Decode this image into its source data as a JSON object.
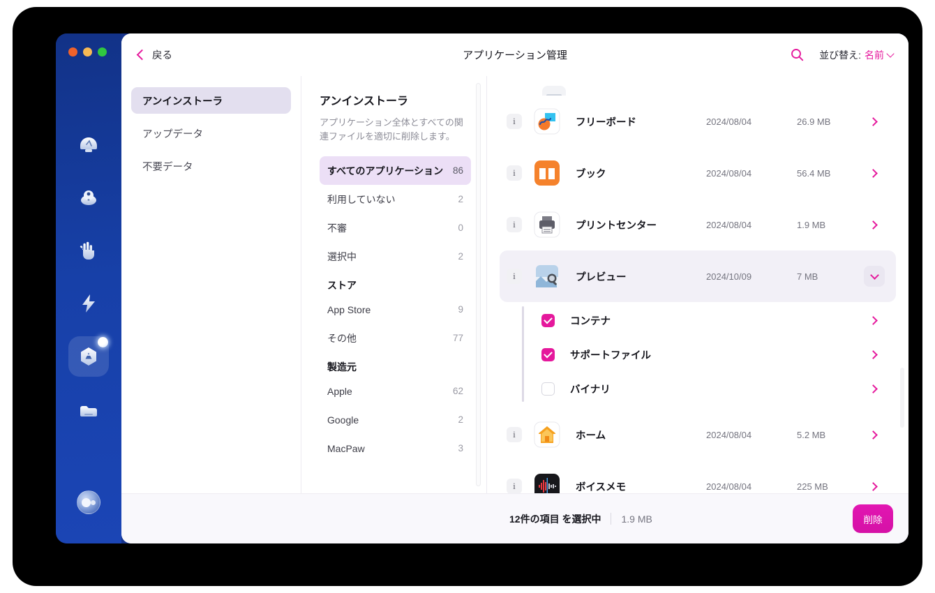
{
  "window": {
    "title": "アプリケーション管理",
    "back_label": "戻る",
    "traffic_lights": [
      "close",
      "minimize",
      "zoom"
    ]
  },
  "toolbar": {
    "search_icon": "search-icon",
    "sort_label": "並び替え:",
    "sort_value": "名前",
    "sort_caret_icon": "chevron-down-icon",
    "accent_color": "#e5189c"
  },
  "module_nav": {
    "items": [
      {
        "label": "アンインストーラ",
        "active": true
      },
      {
        "label": "アップデータ",
        "active": false
      },
      {
        "label": "不要データ",
        "active": false
      }
    ]
  },
  "filter_pane": {
    "title": "アンインストーラ",
    "description": "アプリケーション全体とすべての関連ファイルを適切に削除します。",
    "rows": [
      {
        "label": "すべてのアプリケーション",
        "count": "86",
        "active": true
      },
      {
        "label": "利用していない",
        "count": "2",
        "active": false
      },
      {
        "label": "不審",
        "count": "0",
        "active": false
      },
      {
        "label": "選択中",
        "count": "2",
        "active": false
      }
    ],
    "group_store_title": "ストア",
    "store_rows": [
      {
        "label": "App Store",
        "count": "9"
      },
      {
        "label": "その他",
        "count": "77"
      }
    ],
    "group_vendor_title": "製造元",
    "vendor_rows": [
      {
        "label": "Apple",
        "count": "62"
      },
      {
        "label": "Google",
        "count": "2"
      },
      {
        "label": "MacPaw",
        "count": "3"
      }
    ]
  },
  "app_list": {
    "rows": [
      {
        "name": "フリーボード",
        "date": "2024/08/04",
        "size": "26.9 MB",
        "icon": "freeform-icon",
        "selected": false,
        "expanded": false
      },
      {
        "name": "ブック",
        "date": "2024/08/04",
        "size": "56.4 MB",
        "icon": "books-icon",
        "selected": false,
        "expanded": false
      },
      {
        "name": "プリントセンター",
        "date": "2024/08/04",
        "size": "1.9 MB",
        "icon": "printcenter-icon",
        "selected": false,
        "expanded": false
      },
      {
        "name": "プレビュー",
        "date": "2024/10/09",
        "size": "7 MB",
        "icon": "preview-icon",
        "selected": true,
        "expanded": true
      },
      {
        "name": "ホーム",
        "date": "2024/08/04",
        "size": "5.2 MB",
        "icon": "home-icon",
        "selected": false,
        "expanded": false
      },
      {
        "name": "ボイスメモ",
        "date": "2024/08/04",
        "size": "225 MB",
        "icon": "voicememos-icon",
        "selected": false,
        "expanded": false
      }
    ],
    "sub_items": [
      {
        "label": "コンテナ",
        "checked": true
      },
      {
        "label": "サポートファイル",
        "checked": true
      },
      {
        "label": "バイナリ",
        "checked": false
      }
    ]
  },
  "footer": {
    "selection_count": "12件の項目 を選択中",
    "selection_size": "1.9 MB",
    "delete_label": "削除"
  },
  "rail": {
    "items": [
      {
        "icon": "smart-care-icon",
        "active": false
      },
      {
        "icon": "cleanup-icon",
        "active": false
      },
      {
        "icon": "protection-icon",
        "active": false
      },
      {
        "icon": "performance-icon",
        "active": false
      },
      {
        "icon": "applications-icon",
        "active": true,
        "badge": true
      },
      {
        "icon": "my-clutter-icon",
        "active": false
      }
    ],
    "bottom_icon": "assistant-orb-icon"
  }
}
